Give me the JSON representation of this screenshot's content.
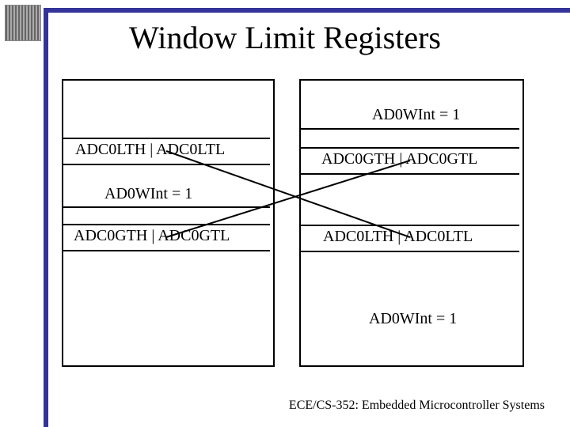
{
  "title": "Window Limit Registers",
  "footer": "ECE/CS-352: Embedded Microcontroller Systems",
  "left": {
    "upper": "ADC0LTH | ADC0LTL",
    "mid": "AD0WInt = 1",
    "lower": "ADC0GTH | ADC0GTL"
  },
  "right": {
    "top": "AD0WInt = 1",
    "upper": "ADC0GTH | ADC0GTL",
    "lower": "ADC0LTH | ADC0LTL",
    "bottom": "AD0WInt = 1"
  }
}
